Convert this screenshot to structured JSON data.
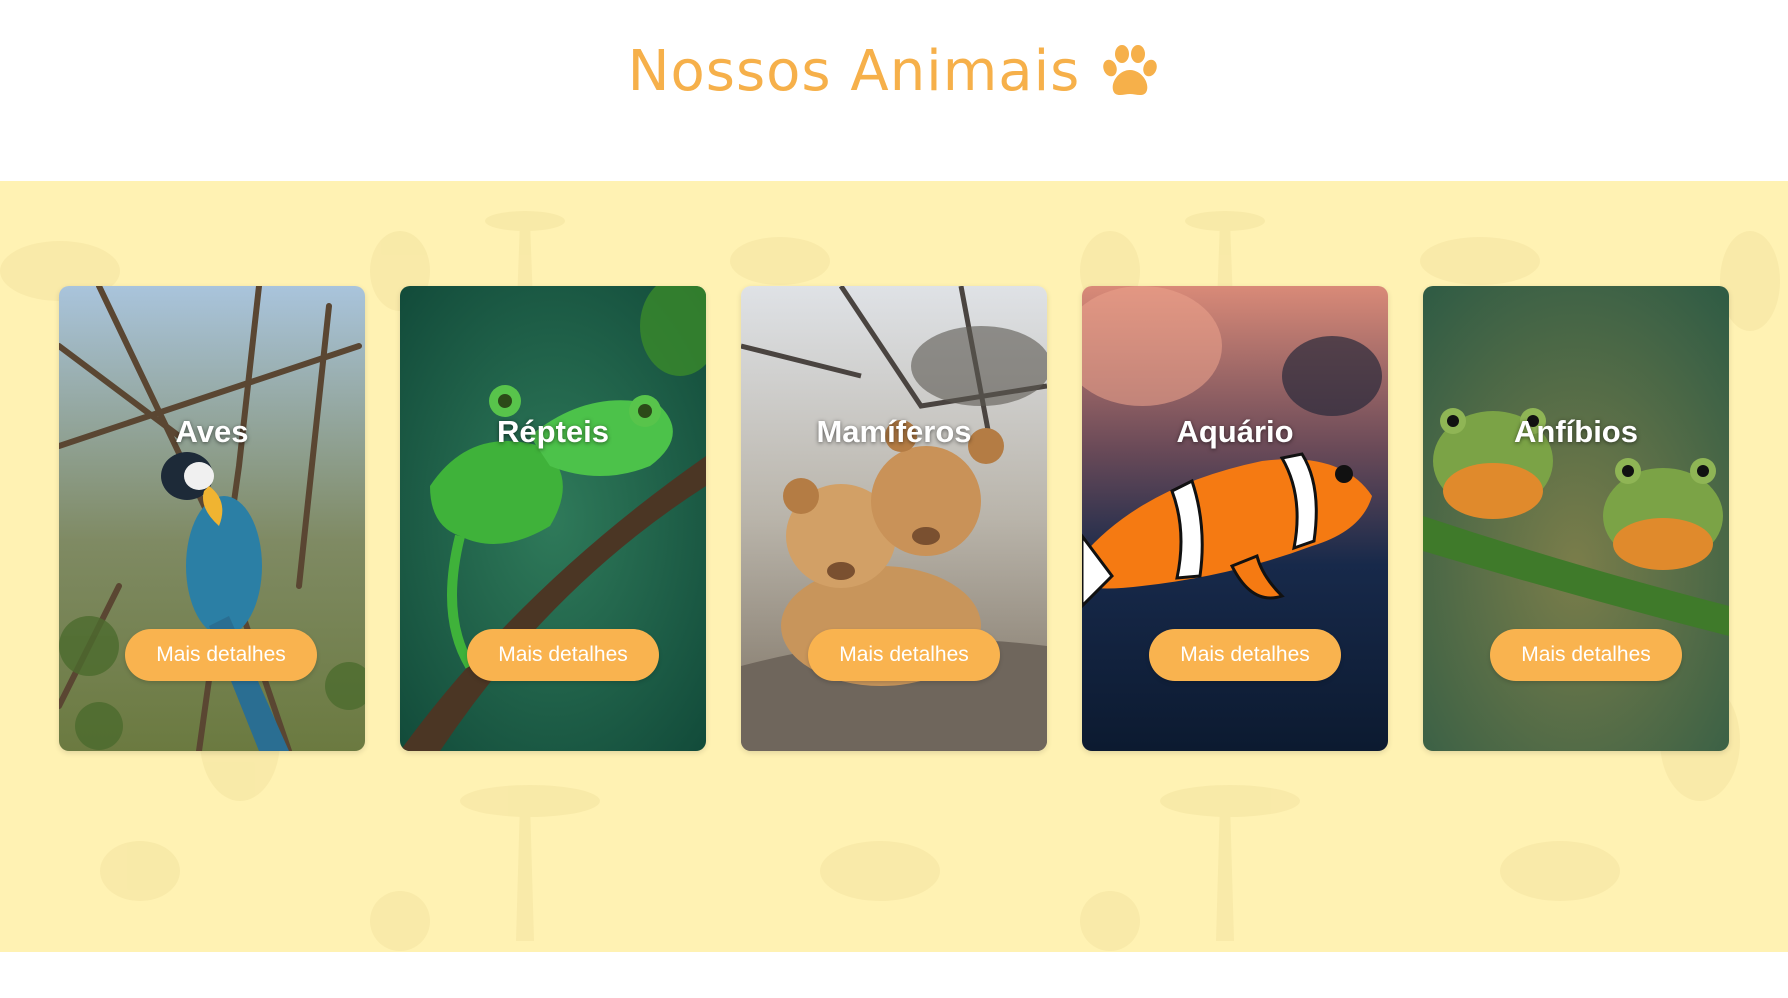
{
  "header": {
    "title": "Nossos Animais",
    "icon": "paw-icon",
    "title_color": "#f6b04a"
  },
  "band": {
    "background_color": "#fff2b3"
  },
  "cards": [
    {
      "title": "Aves",
      "button_label": "Mais detalhes",
      "image": "blue-macaw-parrot"
    },
    {
      "title": "Répteis",
      "button_label": "Mais detalhes",
      "image": "green-chameleons"
    },
    {
      "title": "Mamíferos",
      "button_label": "Mais detalhes",
      "image": "lion-cubs"
    },
    {
      "title": "Aquário",
      "button_label": "Mais detalhes",
      "image": "clownfish"
    },
    {
      "title": "Anfíbios",
      "button_label": "Mais detalhes",
      "image": "tree-frogs"
    }
  ],
  "colors": {
    "button": "#f9b34f",
    "accent": "#f6b04a"
  }
}
